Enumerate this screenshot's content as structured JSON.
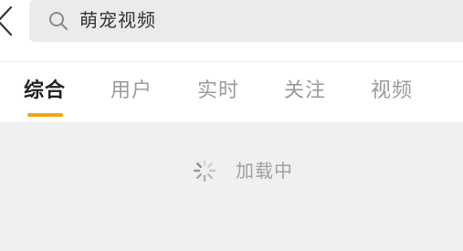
{
  "search": {
    "query": "萌宠视频",
    "icon": "search-icon"
  },
  "nav": {
    "back_icon": "chevron-left-icon"
  },
  "tabs": [
    {
      "label": "综合",
      "active": true
    },
    {
      "label": "用户",
      "active": false
    },
    {
      "label": "实时",
      "active": false
    },
    {
      "label": "关注",
      "active": false
    },
    {
      "label": "视频",
      "active": false
    }
  ],
  "tab_accent_color": "#f0a418",
  "loading": {
    "text": "加载中",
    "icon": "spinner-icon"
  }
}
